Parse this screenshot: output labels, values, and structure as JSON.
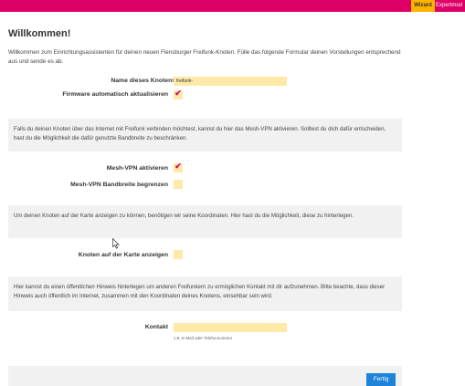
{
  "nav": {
    "wizard_label": "Wizard",
    "expert_label": "Expertmod"
  },
  "page": {
    "title": "Willkommen!",
    "intro": "Willkommen zum Einrichtungsassistenten für deinen neuen Flensburger Freifunk-Knoten. Fülle das folgende Formular deinen Vorstellungen entsprechend aus und sende es ab."
  },
  "form": {
    "node_name_label": "Name dieses Knotens",
    "node_name_value": "freifunk-",
    "autoupdate_label": "Firmware automatisch aktualisieren",
    "autoupdate_checked": true,
    "vpn_info": "Falls du deinen Knoten über das Internet mit Freifunk verbinden möchtest, kannst du hier das Mesh-VPN aktivieren. Solltest du dich dafür entscheiden, hast du die Möglichkeit die dafür genutzte Bandbreite zu beschränken.",
    "vpn_label": "Mesh-VPN aktivieren",
    "vpn_checked": true,
    "bandwidth_label": "Mesh-VPN Bandbreite begrenzen",
    "bandwidth_checked": false,
    "map_info": "Um deinen Knoten auf der Karte anzeigen zu können, benötigen wir seine Koordinaten. Hier hast du die Möglichkeit, diese zu hinterlegen.",
    "map_label": "Knoten auf der Karte anzeigen",
    "map_checked": false,
    "contact_info_1": "Hier kannst du einen ",
    "contact_info_em": "öffentlichen",
    "contact_info_2": " Hinweis hinterlegen um anderen Freifunkern zu ermöglichen Kontakt mit dir aufzunehmen. Bitte beachte, dass dieser Hinweis auch öffentlich im Internet, zusammen mit den Koordinaten deines Knotens, einsehbar sein wird.",
    "contact_label": "Kontakt",
    "contact_value": "",
    "contact_hint": "z.B. E-Mail oder Telefonnummer",
    "check_mark": "✔",
    "submit_label": "Fertig"
  },
  "colors": {
    "brand": "#dc0067",
    "accent": "#ffb400",
    "field": "#ffe9a8",
    "button": "#1e83d9"
  }
}
